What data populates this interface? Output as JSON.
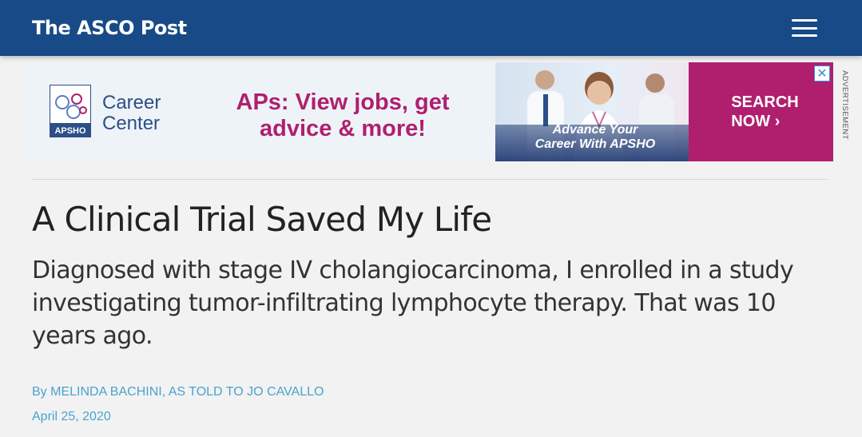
{
  "header": {
    "brand": "The ASCO Post",
    "menu_icon": "hamburger-menu-icon"
  },
  "ad": {
    "logo_label": "APSHO",
    "career_line1": "Career",
    "career_line2": "Center",
    "headline_line1": "APs: View jobs, get",
    "headline_line2": "advice & more!",
    "tagline_line1": "Advance Your",
    "tagline_line2": "Career With APSHO",
    "cta_line1": "SEARCH",
    "cta_line2": "NOW",
    "cta_arrow": "›",
    "close_symbol": "✕",
    "side_label": "ADVERTISEMENT",
    "colors": {
      "accent": "#b01f6e",
      "navy": "#2b4f86"
    }
  },
  "article": {
    "title": "A Clinical Trial Saved My Life",
    "subtitle": "Diagnosed with stage IV cholangiocarcinoma, I enrolled in a study investigating tumor-infiltrating lymphocyte therapy. That was 10 years ago.",
    "byline": "By MELINDA BACHINI, AS TOLD TO JO CAVALLO",
    "date": "April 25, 2020"
  },
  "colors": {
    "header_bg": "#174a87",
    "link": "#4aa3ce"
  }
}
